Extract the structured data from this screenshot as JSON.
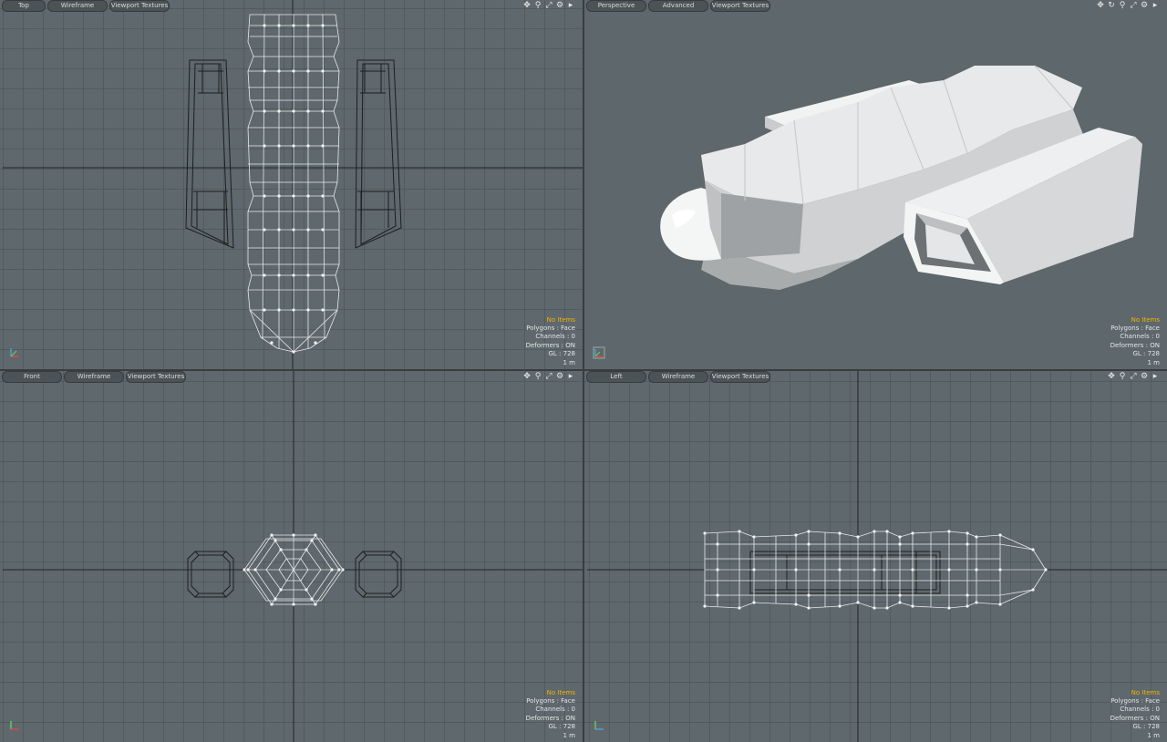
{
  "viewports": {
    "top": {
      "tabs": [
        "Top",
        "Wireframe",
        "Viewport Textures"
      ]
    },
    "perspective": {
      "tabs": [
        "Perspective",
        "Advanced",
        "Viewport Textures"
      ]
    },
    "front": {
      "tabs": [
        "Front",
        "Wireframe",
        "Viewport Textures"
      ]
    },
    "left": {
      "tabs": [
        "Left",
        "Wireframe",
        "Viewport Textures"
      ]
    }
  },
  "info": {
    "items": "No Items",
    "polygons": "Polygons : Face",
    "channels": "Channels : 0",
    "deformers": "Deformers : ON",
    "gl": "GL : 728",
    "scale": "1 m"
  },
  "icons": {
    "move": "move-view-icon",
    "rotate": "rotate-view-icon",
    "zoom": "zoom-view-icon",
    "fit": "fit-view-icon",
    "settings": "gear-icon",
    "menu": "arrow-menu-icon"
  },
  "colors": {
    "viewport_bg": "#5f686c",
    "grid": "#485054",
    "wire_selected": "#e8eaeb",
    "wire_dark": "#1c1f21",
    "info_highlight": "#f0b400"
  }
}
